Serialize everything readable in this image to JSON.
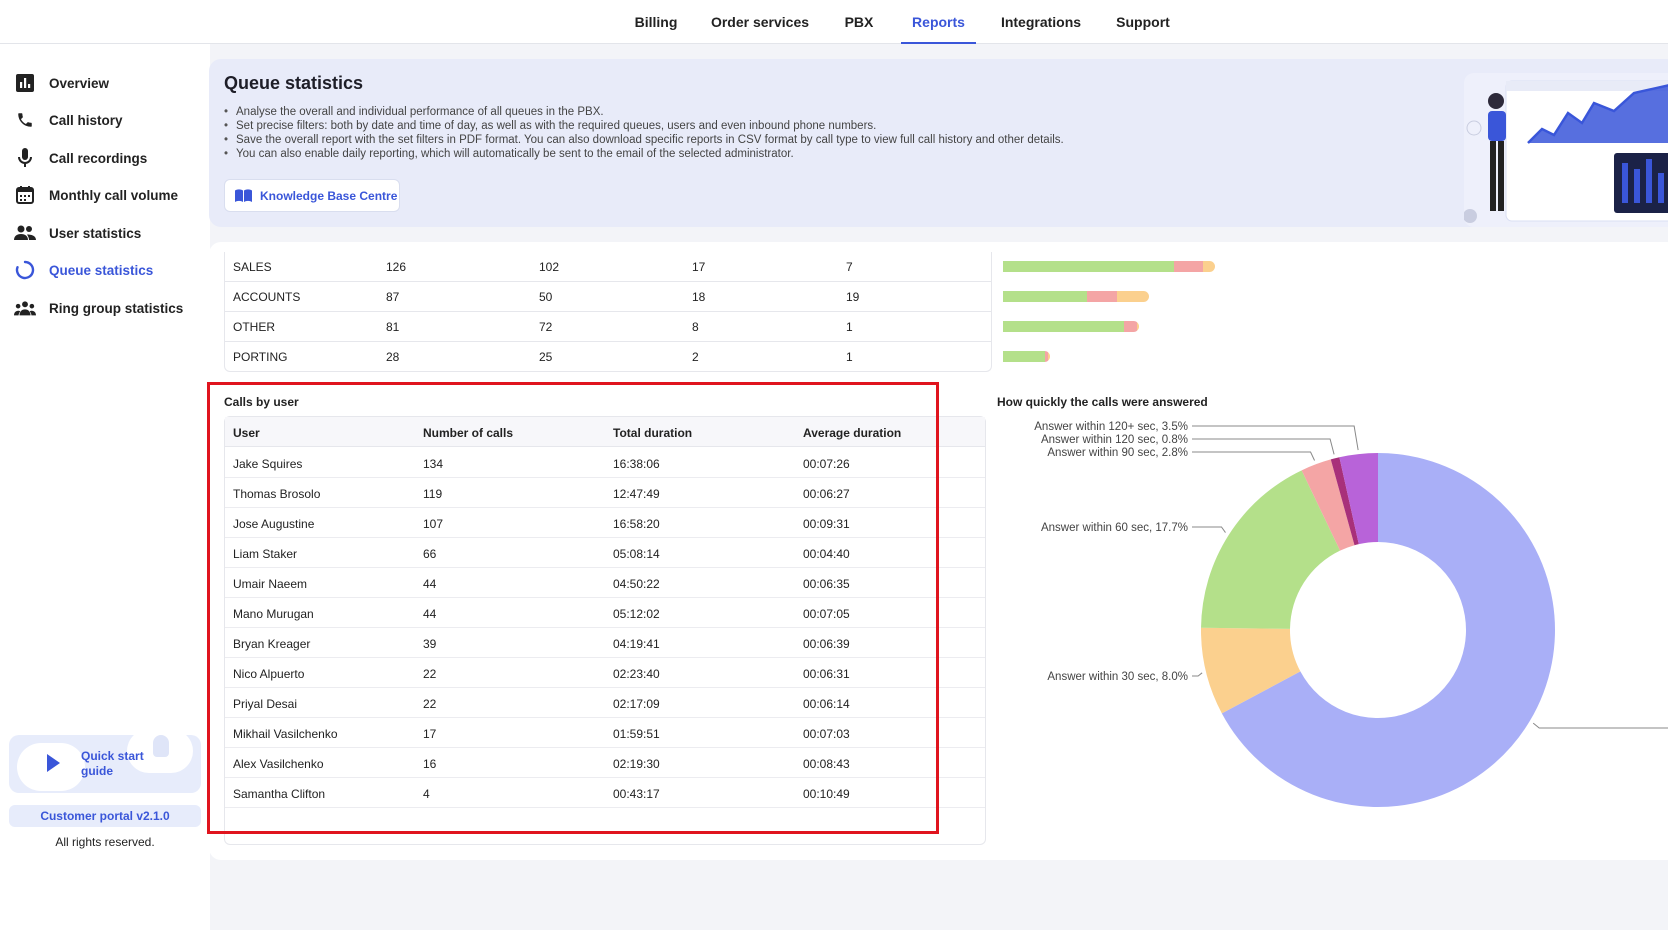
{
  "topnav": {
    "tabs": [
      "Billing",
      "Order services",
      "PBX",
      "Reports",
      "Integrations",
      "Support"
    ],
    "active": "Reports"
  },
  "sidebar": {
    "items": [
      {
        "label": "Overview",
        "icon": "bar-chart-icon"
      },
      {
        "label": "Call history",
        "icon": "phone-icon"
      },
      {
        "label": "Call recordings",
        "icon": "microphone-icon"
      },
      {
        "label": "Monthly call volume",
        "icon": "calendar-icon"
      },
      {
        "label": "User statistics",
        "icon": "users-icon"
      },
      {
        "label": "Queue statistics",
        "icon": "spinner-icon",
        "active": true
      },
      {
        "label": "Ring group statistics",
        "icon": "group-icon"
      }
    ],
    "quick_start": "Quick start guide",
    "version": "Customer portal v2.1.0",
    "rights": "All rights reserved."
  },
  "hero": {
    "title": "Queue statistics",
    "bullets": [
      "Analyse the overall and individual performance of all queues in the PBX.",
      "Set precise filters: both by date and time of day, as well as with the required queues, users and even inbound phone numbers.",
      "Save the overall report with the set filters in PDF format. You can also download specific reports in CSV format by call type to view full call history and other details.",
      "You can also enable daily reporting, which will automatically be sent to the email of the selected administrator."
    ],
    "kb_button": "Knowledge Base Centre"
  },
  "queues": {
    "rows": [
      {
        "name": "SALES",
        "c1": "126",
        "c2": "102",
        "c3": "17",
        "c4": "7"
      },
      {
        "name": "ACCOUNTS",
        "c1": "87",
        "c2": "50",
        "c3": "18",
        "c4": "19"
      },
      {
        "name": "OTHER",
        "c1": "81",
        "c2": "72",
        "c3": "8",
        "c4": "1"
      },
      {
        "name": "PORTING",
        "c1": "28",
        "c2": "25",
        "c3": "2",
        "c4": "1"
      }
    ],
    "bar_colors": {
      "answered": "#b4e08a",
      "missed": "#f4a5a5",
      "other": "#fbd08e"
    }
  },
  "calls_by_user": {
    "title": "Calls by user",
    "columns": [
      "User",
      "Number of calls",
      "Total duration",
      "Average duration"
    ],
    "rows": [
      [
        "Jake Squires",
        "134",
        "16:38:06",
        "00:07:26"
      ],
      [
        "Thomas Brosolo",
        "119",
        "12:47:49",
        "00:06:27"
      ],
      [
        "Jose Augustine",
        "107",
        "16:58:20",
        "00:09:31"
      ],
      [
        "Liam Staker",
        "66",
        "05:08:14",
        "00:04:40"
      ],
      [
        "Umair Naeem",
        "44",
        "04:50:22",
        "00:06:35"
      ],
      [
        "Mano Murugan",
        "44",
        "05:12:02",
        "00:07:05"
      ],
      [
        "Bryan Kreager",
        "39",
        "04:19:41",
        "00:06:39"
      ],
      [
        "Nico Alpuerto",
        "22",
        "02:23:40",
        "00:06:31"
      ],
      [
        "Priyal Desai",
        "22",
        "02:17:09",
        "00:06:14"
      ],
      [
        "Mikhail Vasilchenko",
        "17",
        "01:59:51",
        "00:07:03"
      ],
      [
        "Alex Vasilchenko",
        "16",
        "02:19:30",
        "00:08:43"
      ],
      [
        "Samantha Clifton",
        "4",
        "00:43:17",
        "00:10:49"
      ]
    ]
  },
  "chart_data": {
    "type": "pie",
    "title": "How quickly the calls were answered",
    "slices": [
      {
        "label": "Answer within 30 sec",
        "label_text": "",
        "value": 67.2,
        "color": "#a9aff7"
      },
      {
        "label": "Answer within 30 sec",
        "label_text": "Answer within 30 sec, 8.0%",
        "value": 8.0,
        "color": "#fbd08e"
      },
      {
        "label": "Answer within 60 sec",
        "label_text": "Answer within 60 sec, 17.7%",
        "value": 17.7,
        "color": "#b4e08a"
      },
      {
        "label": "Answer within 90 sec",
        "label_text": "Answer within 90 sec, 2.8%",
        "value": 2.8,
        "color": "#f4a5a5"
      },
      {
        "label": "Answer within 120 sec",
        "label_text": "Answer within 120 sec, 0.8%",
        "value": 0.8,
        "color": "#a8307a"
      },
      {
        "label": "Answer within 120+ sec",
        "label_text": "Answer within 120+ sec, 3.5%",
        "value": 3.5,
        "color": "#b863d9"
      }
    ]
  },
  "colors": {
    "accent": "#3a56d9",
    "highlight": "#e0141e",
    "hero_bg": "#e8ebf9"
  }
}
